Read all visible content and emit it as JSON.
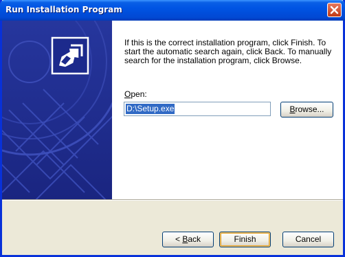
{
  "window": {
    "title": "Run Installation Program"
  },
  "content": {
    "description": "If this is the correct installation program, click Finish. To start the automatic search again, click Back. To manually search for the installation program, click Browse.",
    "open_label_key": "O",
    "open_label_rest": "pen:",
    "open_value": "D:\\Setup.exe"
  },
  "buttons": {
    "browse_key": "B",
    "browse_rest": "rowse...",
    "back_prefix": "< ",
    "back_key": "B",
    "back_rest": "ack",
    "finish": "Finish",
    "cancel": "Cancel"
  },
  "colors": {
    "titlebar": "#0054e3",
    "side_panel": "#1c2a8c",
    "dialog_bg": "#ece9d8",
    "selection": "#316ac5"
  },
  "icons": [
    "close-icon",
    "install-arrow-icon",
    "cd-disc-graphic"
  ]
}
